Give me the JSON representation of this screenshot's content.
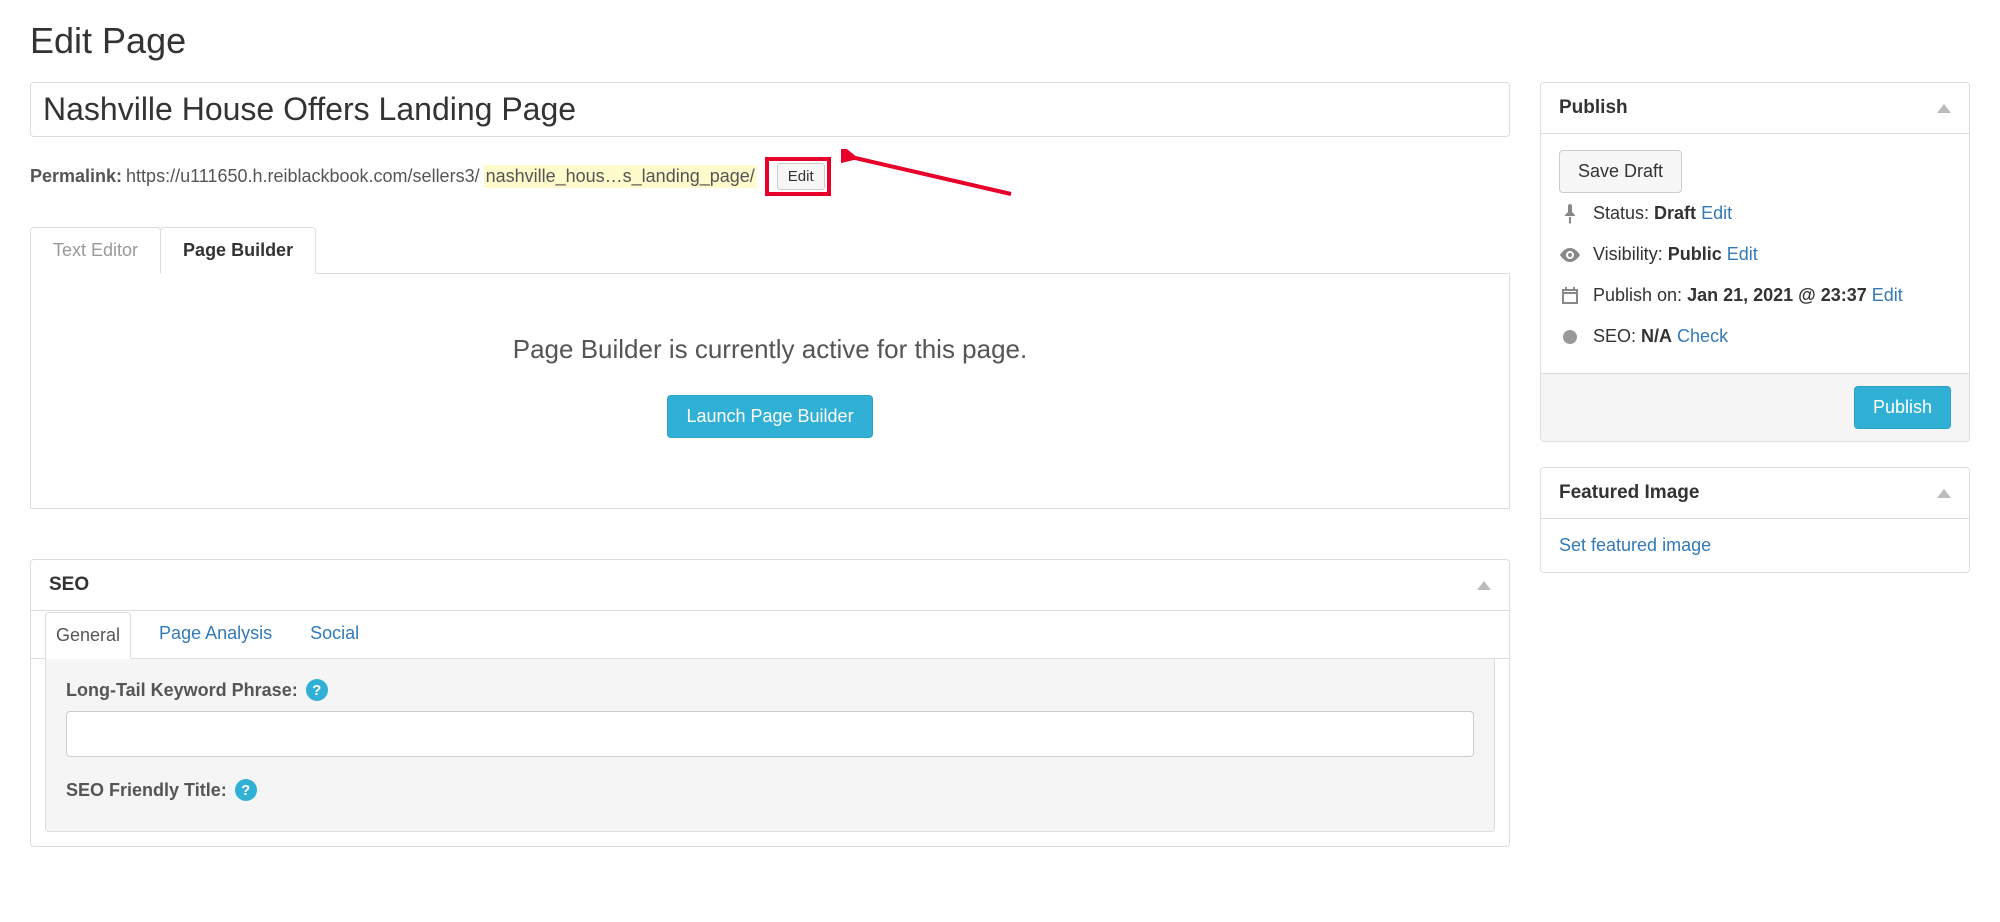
{
  "heading": "Edit Page",
  "title_value": "Nashville House Offers Landing Page",
  "permalink": {
    "label": "Permalink:",
    "base": "https://u111650.h.reiblackbook.com/sellers3/",
    "slug": "nashville_hous…s_landing_page/",
    "edit_label": "Edit"
  },
  "editor_tabs": {
    "text": "Text Editor",
    "builder": "Page Builder"
  },
  "builder_panel": {
    "message": "Page Builder is currently active for this page.",
    "launch_label": "Launch Page Builder"
  },
  "seo": {
    "heading": "SEO",
    "tabs": {
      "general": "General",
      "analysis": "Page Analysis",
      "social": "Social"
    },
    "longtail_label": "Long-Tail Keyword Phrase:",
    "friendly_title_label": "SEO Friendly Title:"
  },
  "publish": {
    "heading": "Publish",
    "save_draft": "Save Draft",
    "status_label": "Status:",
    "status_value": "Draft",
    "edit": "Edit",
    "visibility_label": "Visibility:",
    "visibility_value": "Public",
    "publish_on_label": "Publish on:",
    "publish_on_value": "Jan 21, 2021 @ 23:37",
    "seo_label": "SEO:",
    "seo_value": "N/A",
    "check": "Check",
    "publish_button": "Publish"
  },
  "featured_image": {
    "heading": "Featured Image",
    "set_link": "Set featured image"
  }
}
